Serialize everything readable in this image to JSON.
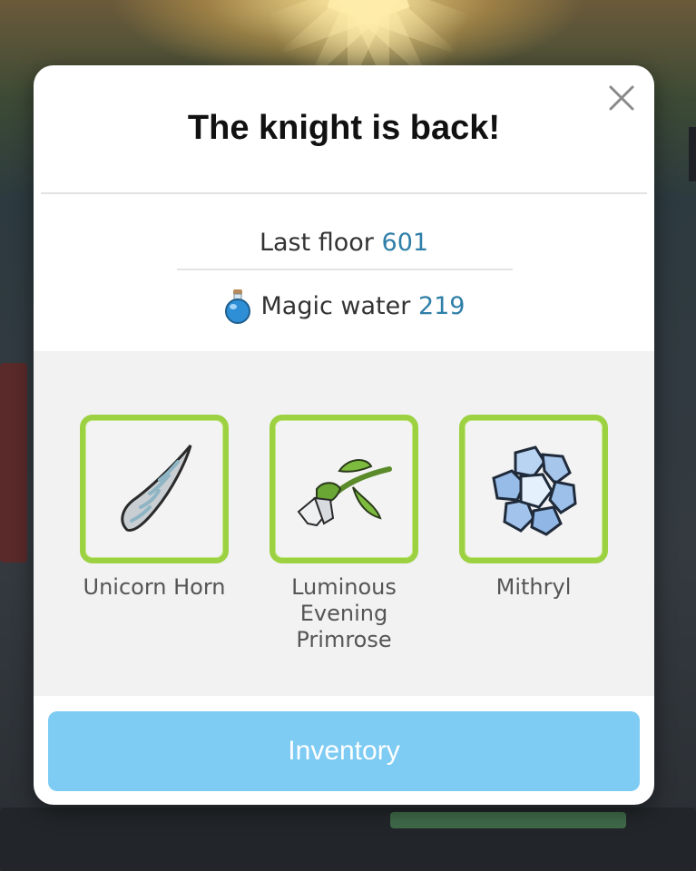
{
  "dialog": {
    "title": "The knight is back!",
    "close_icon": "close-icon"
  },
  "stats": {
    "last_floor_label": "Last floor",
    "last_floor_value": "601",
    "magic_water_icon": "potion-icon",
    "magic_water_label": "Magic water",
    "magic_water_value": "219"
  },
  "rewards": [
    {
      "name": "Unicorn Horn",
      "icon": "unicorn-horn-icon"
    },
    {
      "name": "Luminous Evening Primrose",
      "icon": "primrose-flower-icon"
    },
    {
      "name": "Mithryl",
      "icon": "mithryl-ore-icon"
    }
  ],
  "actions": {
    "inventory_label": "Inventory"
  },
  "colors": {
    "accent_number": "#2f7fa8",
    "item_border": "#9cd141",
    "button_bg": "#7ecbf3"
  }
}
